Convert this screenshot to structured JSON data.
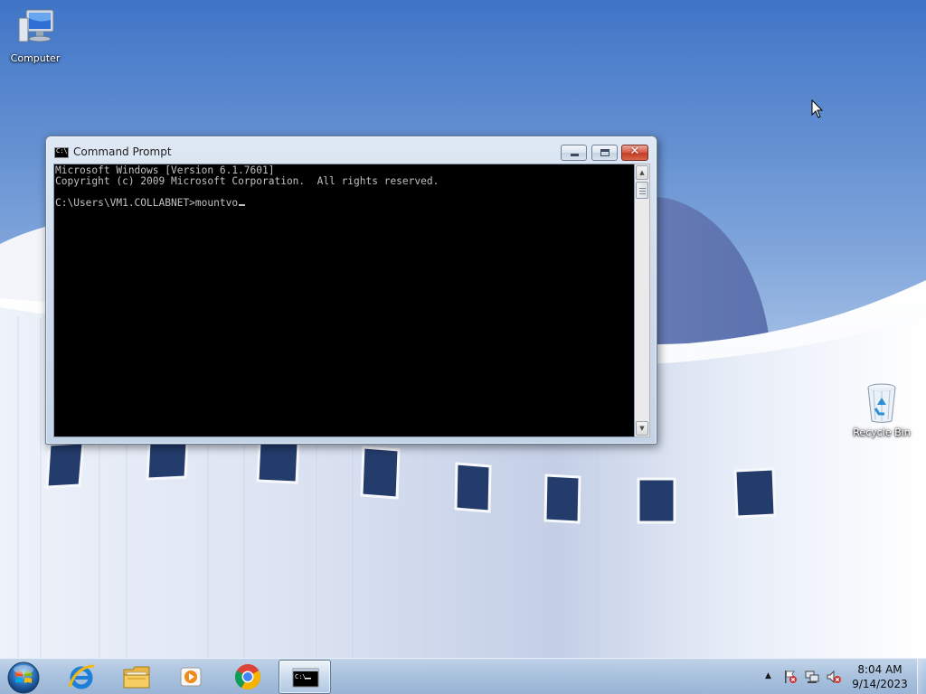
{
  "desktop": {
    "icons": [
      {
        "label": "Computer",
        "icon": "computer-icon"
      },
      {
        "label": "Recycle Bin",
        "icon": "recycle-bin-icon"
      }
    ]
  },
  "cmd_window": {
    "title": "Command Prompt",
    "title_icon_text": "C:\\",
    "console_lines": [
      "Microsoft Windows [Version 6.1.7601]",
      "Copyright (c) 2009 Microsoft Corporation.  All rights reserved.",
      "",
      "C:\\Users\\VM1.COLLABNET>mountvo"
    ],
    "close_glyph": "✕"
  },
  "taskbar": {
    "pinned": [
      {
        "name": "start-button",
        "icon": "windows-orb-icon"
      },
      {
        "name": "internet-explorer",
        "icon": "internet-explorer-icon"
      },
      {
        "name": "windows-explorer",
        "icon": "folder-icon"
      },
      {
        "name": "windows-media-player",
        "icon": "media-player-icon"
      },
      {
        "name": "google-chrome",
        "icon": "chrome-icon"
      },
      {
        "name": "command-prompt",
        "icon": "cmd-icon",
        "active": true
      }
    ],
    "tray": {
      "overflow_glyph": "▲",
      "icons": [
        "action-center-flag-icon",
        "network-icon",
        "volume-muted-icon"
      ],
      "time": "8:04 AM",
      "date": "9/14/2023"
    }
  },
  "colors": {
    "console_bg": "#000000",
    "console_text": "#c0c0c0",
    "close_button": "#c8452d",
    "taskbar": "#a8c1de"
  }
}
